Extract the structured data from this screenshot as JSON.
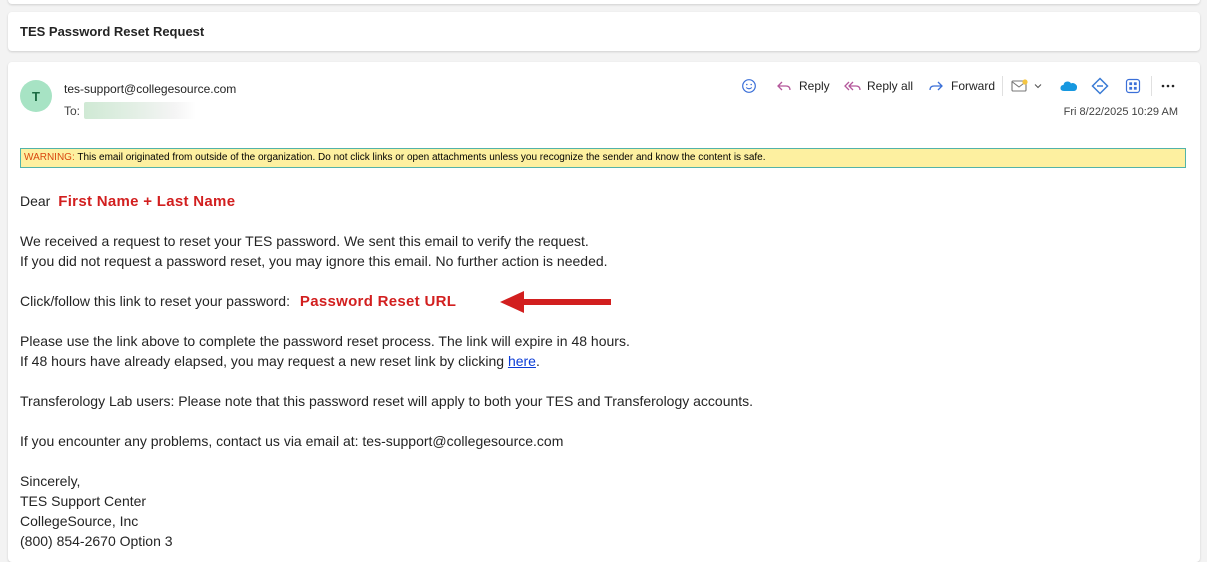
{
  "subject": "TES Password Reset Request",
  "sender": {
    "initial": "T",
    "email": "tes-support@collegesource.com",
    "to_label": "To:"
  },
  "toolbar": {
    "reply_label": "Reply",
    "reply_all_label": "Reply all",
    "forward_label": "Forward"
  },
  "date": "Fri 8/22/2025 10:29 AM",
  "warning": {
    "label": "WARNING:",
    "text": " This email originated from outside of the organization. Do not click links or open attachments unless you recognize the sender and know the content is safe."
  },
  "body": {
    "greeting": "Dear",
    "name_placeholder": "First Name + Last Name",
    "para1_line1": "We received a request to reset your TES password. We sent this email to verify the request.",
    "para1_line2": "If you did not request a password reset, you may ignore this email. No further action is needed.",
    "link_prompt": "Click/follow this link to reset your password:",
    "reset_url_placeholder": "Password Reset URL",
    "para3_line1": "Please use the link above to complete the password reset process. The link will expire in 48 hours.",
    "para3_line2_prefix": "If 48 hours have already elapsed, you may request a new reset link by clicking ",
    "here_link": "here",
    "para3_line2_suffix": ".",
    "para4": "Transferology Lab users: Please note that this password reset will apply to both your TES and Transferology accounts.",
    "para5": "If you encounter any problems, contact us via email at: tes-support@collegesource.com",
    "sig1": "Sincerely,",
    "sig2": "TES Support Center",
    "sig3": "CollegeSource, Inc",
    "sig4": "(800) 854-2670 Option 3"
  },
  "colors": {
    "accent_red": "#d21f1f",
    "link_blue": "#0b3cd6",
    "warning_bg": "#fdf0a0",
    "avatar_bg": "#a7e3c4"
  }
}
